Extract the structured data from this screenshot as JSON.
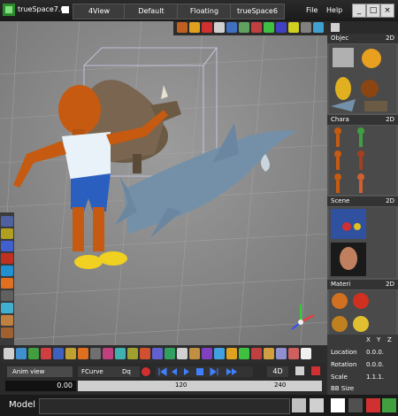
{
  "titlebar": {
    "app_title": "trueSpace7.6",
    "segments": [
      "4View",
      "Default",
      "Floating",
      "trueSpace6"
    ],
    "menu": [
      "File",
      "Help"
    ],
    "window_buttons": [
      "_",
      "□",
      "×"
    ]
  },
  "panels": [
    {
      "title": "Objec",
      "badge": "2D"
    },
    {
      "title": "Chara",
      "badge": "2D"
    },
    {
      "title": "Scene",
      "badge": "2D"
    },
    {
      "title": "Materi",
      "badge": "2D"
    }
  ],
  "coords": {
    "axes": [
      "X",
      "Y",
      "Z"
    ],
    "rows": [
      {
        "label": "Location",
        "value": "0.0.0."
      },
      {
        "label": "Rotation",
        "value": "0.0.0."
      },
      {
        "label": "Scale",
        "value": "1.1.1."
      },
      {
        "label": "BB Size",
        "value": ""
      }
    ]
  },
  "anim": {
    "tabs": [
      "Anim view",
      "FCurve",
      "Dq"
    ],
    "frame_value": "0.00",
    "ruler_marks": [
      "120",
      "240"
    ],
    "badge": "4D"
  },
  "status": {
    "mode_label": "Model"
  }
}
